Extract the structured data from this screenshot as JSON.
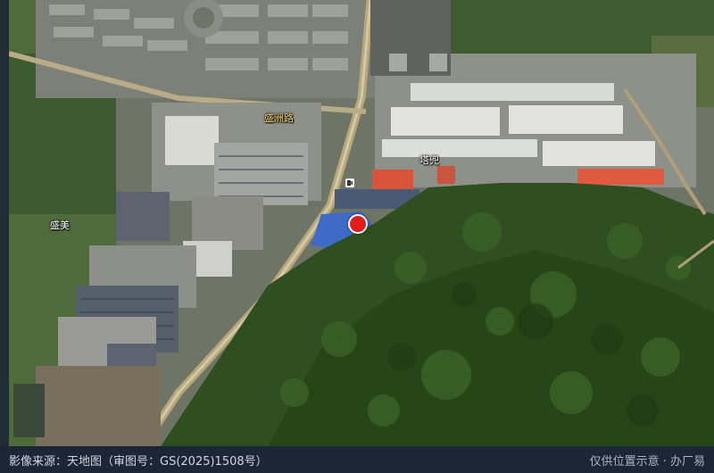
{
  "map": {
    "labels": {
      "road": "盛洲路",
      "place_a": "塔兜",
      "place_b": "盛美"
    },
    "marker_icon": "location-pin-icon",
    "poi_icon": "fuel-station-icon",
    "colors": {
      "marker": "#e21b1b",
      "road_label": "#f3d36b",
      "footer_bg": "#1d2636"
    }
  },
  "footer": {
    "attribution": "影像来源：天地图（审图号：GS(2025)1508号）",
    "notice": "仅供位置示意 · 办厂易"
  }
}
